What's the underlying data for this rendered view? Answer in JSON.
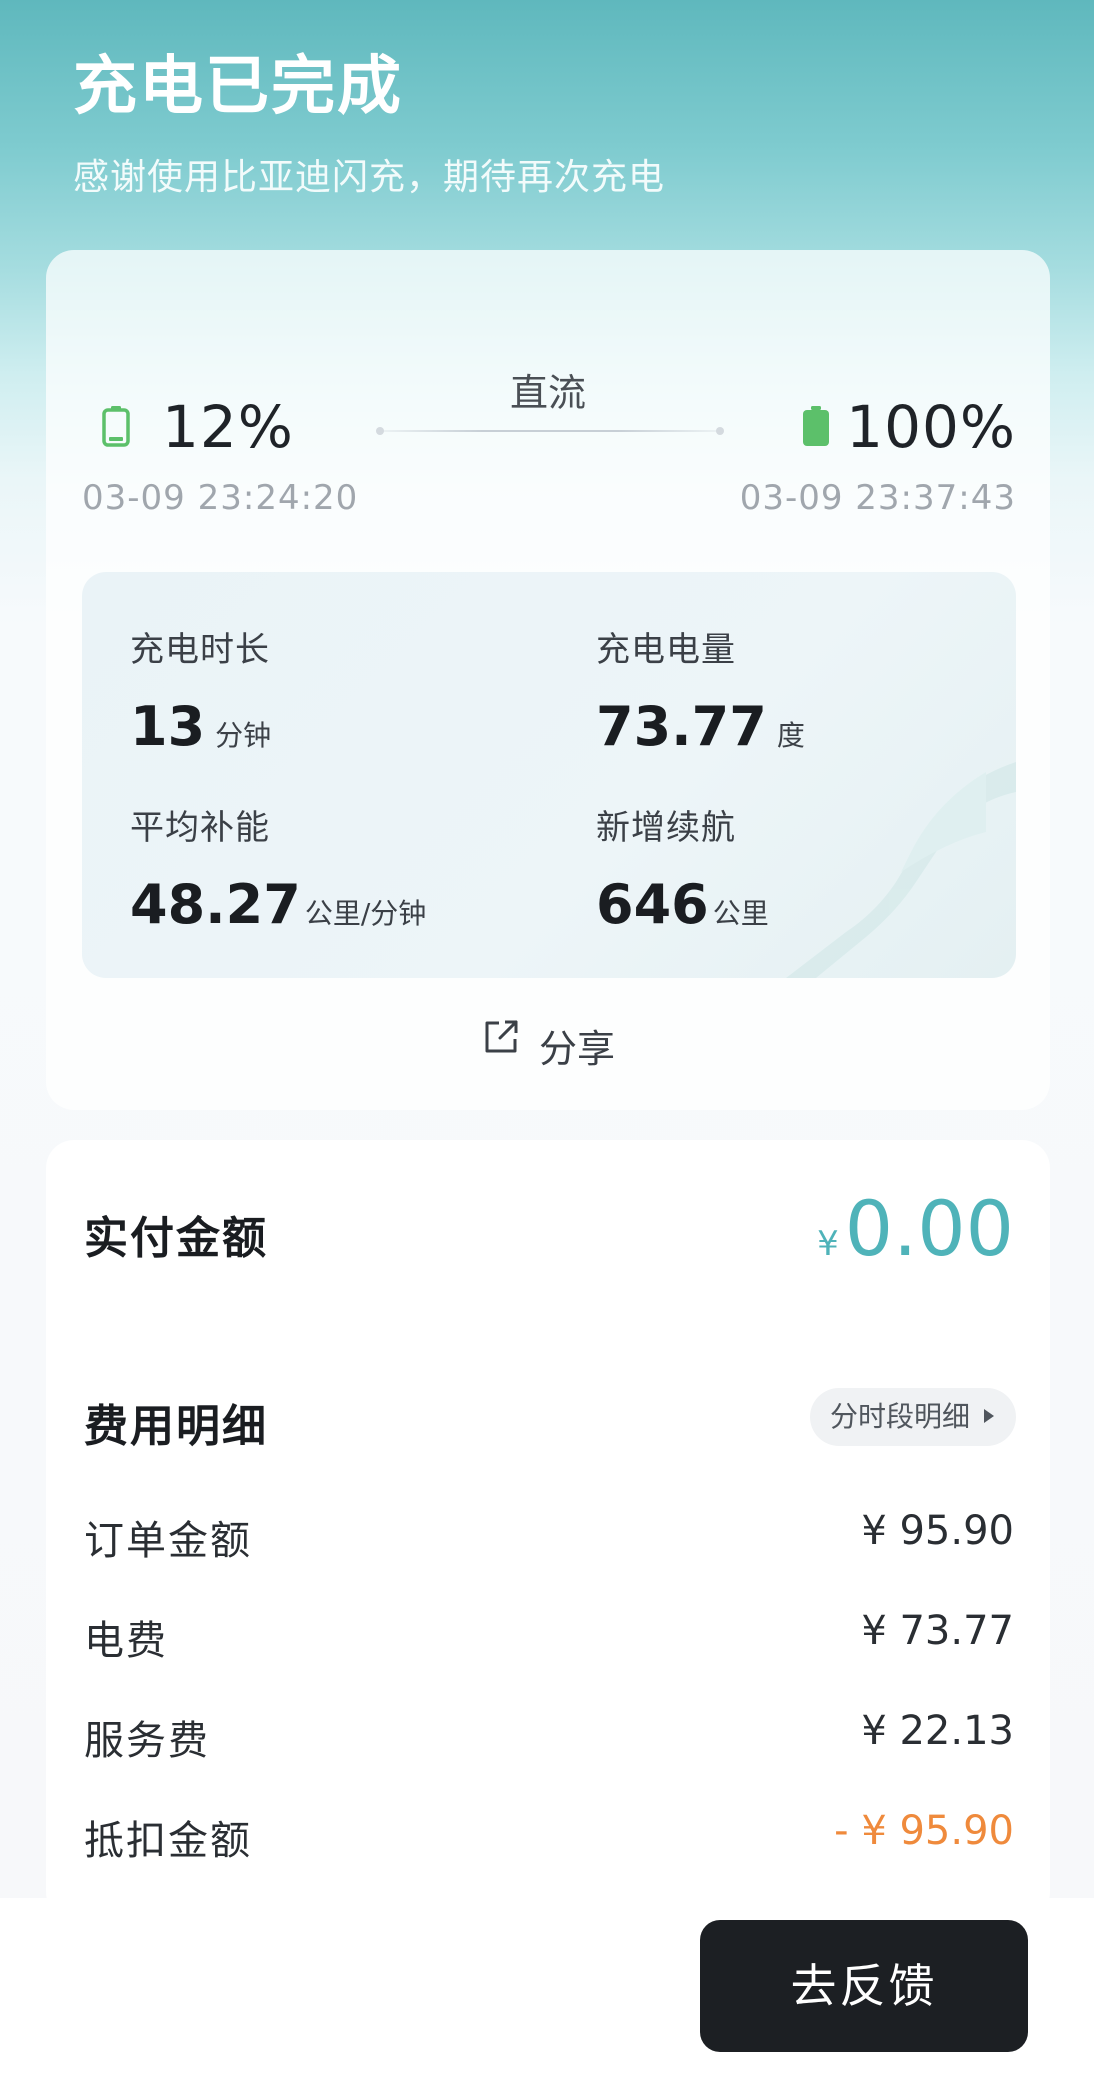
{
  "header": {
    "title": "充电已完成",
    "subtitle": "感谢使用比亚迪闪充，期待再次充电"
  },
  "charge": {
    "mode": "直流",
    "start": {
      "percent": "12%",
      "time": "03-09 23:24:20",
      "battery_icon": "battery-low-icon"
    },
    "end": {
      "percent": "100%",
      "time": "03-09 23:37:43",
      "battery_icon": "battery-full-icon"
    },
    "stats": [
      {
        "label": "充电时长",
        "value": "13",
        "unit": "分钟"
      },
      {
        "label": "充电电量",
        "value": "73.77",
        "unit": "度"
      },
      {
        "label": "平均补能",
        "value": "48.27",
        "unit": "公里/分钟"
      },
      {
        "label": "新增续航",
        "value": "646",
        "unit": "公里"
      }
    ],
    "share_label": "分享"
  },
  "payment": {
    "label": "实付金额",
    "currency": "¥",
    "amount": "0.00",
    "detail_title": "费用明细",
    "period_button": "分时段明细",
    "rows": [
      {
        "label": "订单金额",
        "value": "¥ 95.90"
      },
      {
        "label": "电费",
        "value": "¥ 73.77"
      },
      {
        "label": "服务费",
        "value": "¥ 22.13"
      },
      {
        "label": "抵扣金额",
        "value": "- ¥ 95.90"
      }
    ]
  },
  "footer": {
    "feedback_label": "去反馈"
  },
  "colors": {
    "accent": "#4fb3b9",
    "battery_green": "#5cc06a",
    "deduction": "#ef8a3c",
    "button_dark": "#1c1f23"
  }
}
